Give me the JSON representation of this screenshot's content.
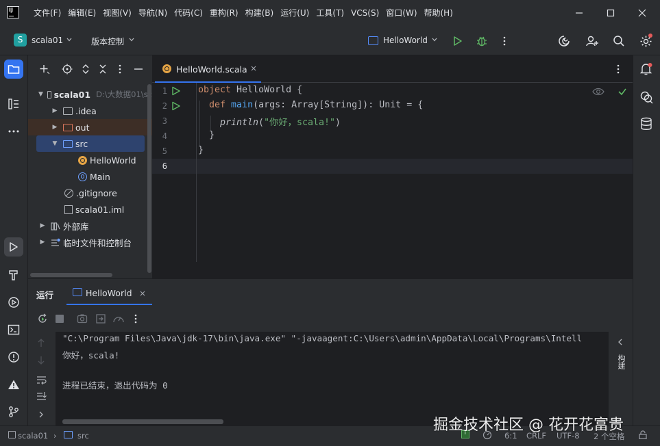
{
  "menu": {
    "items": [
      "文件(F)",
      "编辑(E)",
      "视图(V)",
      "导航(N)",
      "代码(C)",
      "重构(R)",
      "构建(B)",
      "运行(U)",
      "工具(T)",
      "VCS(S)",
      "窗口(W)",
      "帮助(H)"
    ]
  },
  "toolbar": {
    "project_badge": "S",
    "project_name": "scala01",
    "vcs_label": "版本控制",
    "run_config": "HelloWorld"
  },
  "project_tree": {
    "root_name": "scala01",
    "root_path": "D:\\大数据01\\sc",
    "items": [
      ".idea",
      "out",
      "src",
      "HelloWorld",
      "Main",
      ".gitignore",
      "scala01.iml",
      "外部库",
      "临时文件和控制台"
    ]
  },
  "editor": {
    "tab_label": "HelloWorld.scala",
    "line_numbers": [
      "1",
      "2",
      "3",
      "4",
      "5",
      "6"
    ],
    "code": {
      "l1_kw": "object",
      "l1_rest": " HelloWorld {",
      "l2_kw": "def",
      "l2_fn": "main",
      "l2_rest": "(args: Array[String]): Unit = {",
      "l3_fn": "println",
      "l3_open": "(",
      "l3_str": "\"你好，scala!\"",
      "l3_close": ")",
      "l4": "}",
      "l5": "}"
    }
  },
  "run_panel": {
    "title": "运行",
    "tab_label": "HelloWorld",
    "console_lines": [
      "\"C:\\Program Files\\Java\\jdk-17\\bin\\java.exe\" \"-javaagent:C:\\Users\\admin\\AppData\\Local\\Programs\\Intell",
      "你好，scala!",
      "",
      "进程已结束，退出代码为 0"
    ],
    "side_label": "构建"
  },
  "status_bar": {
    "crumb_project": "scala01",
    "crumb_folder": "src",
    "position": "6:1",
    "line_sep": "CRLF",
    "encoding": "UTF-8",
    "indent": "2 个空格"
  },
  "watermark": "掘金技术社区 @ 花开花富贵",
  "colors": {
    "accent": "#3574f0",
    "keyword": "#cf8e6d",
    "function": "#56a8f5",
    "string": "#6aab73",
    "run_green": "#5fb865"
  }
}
